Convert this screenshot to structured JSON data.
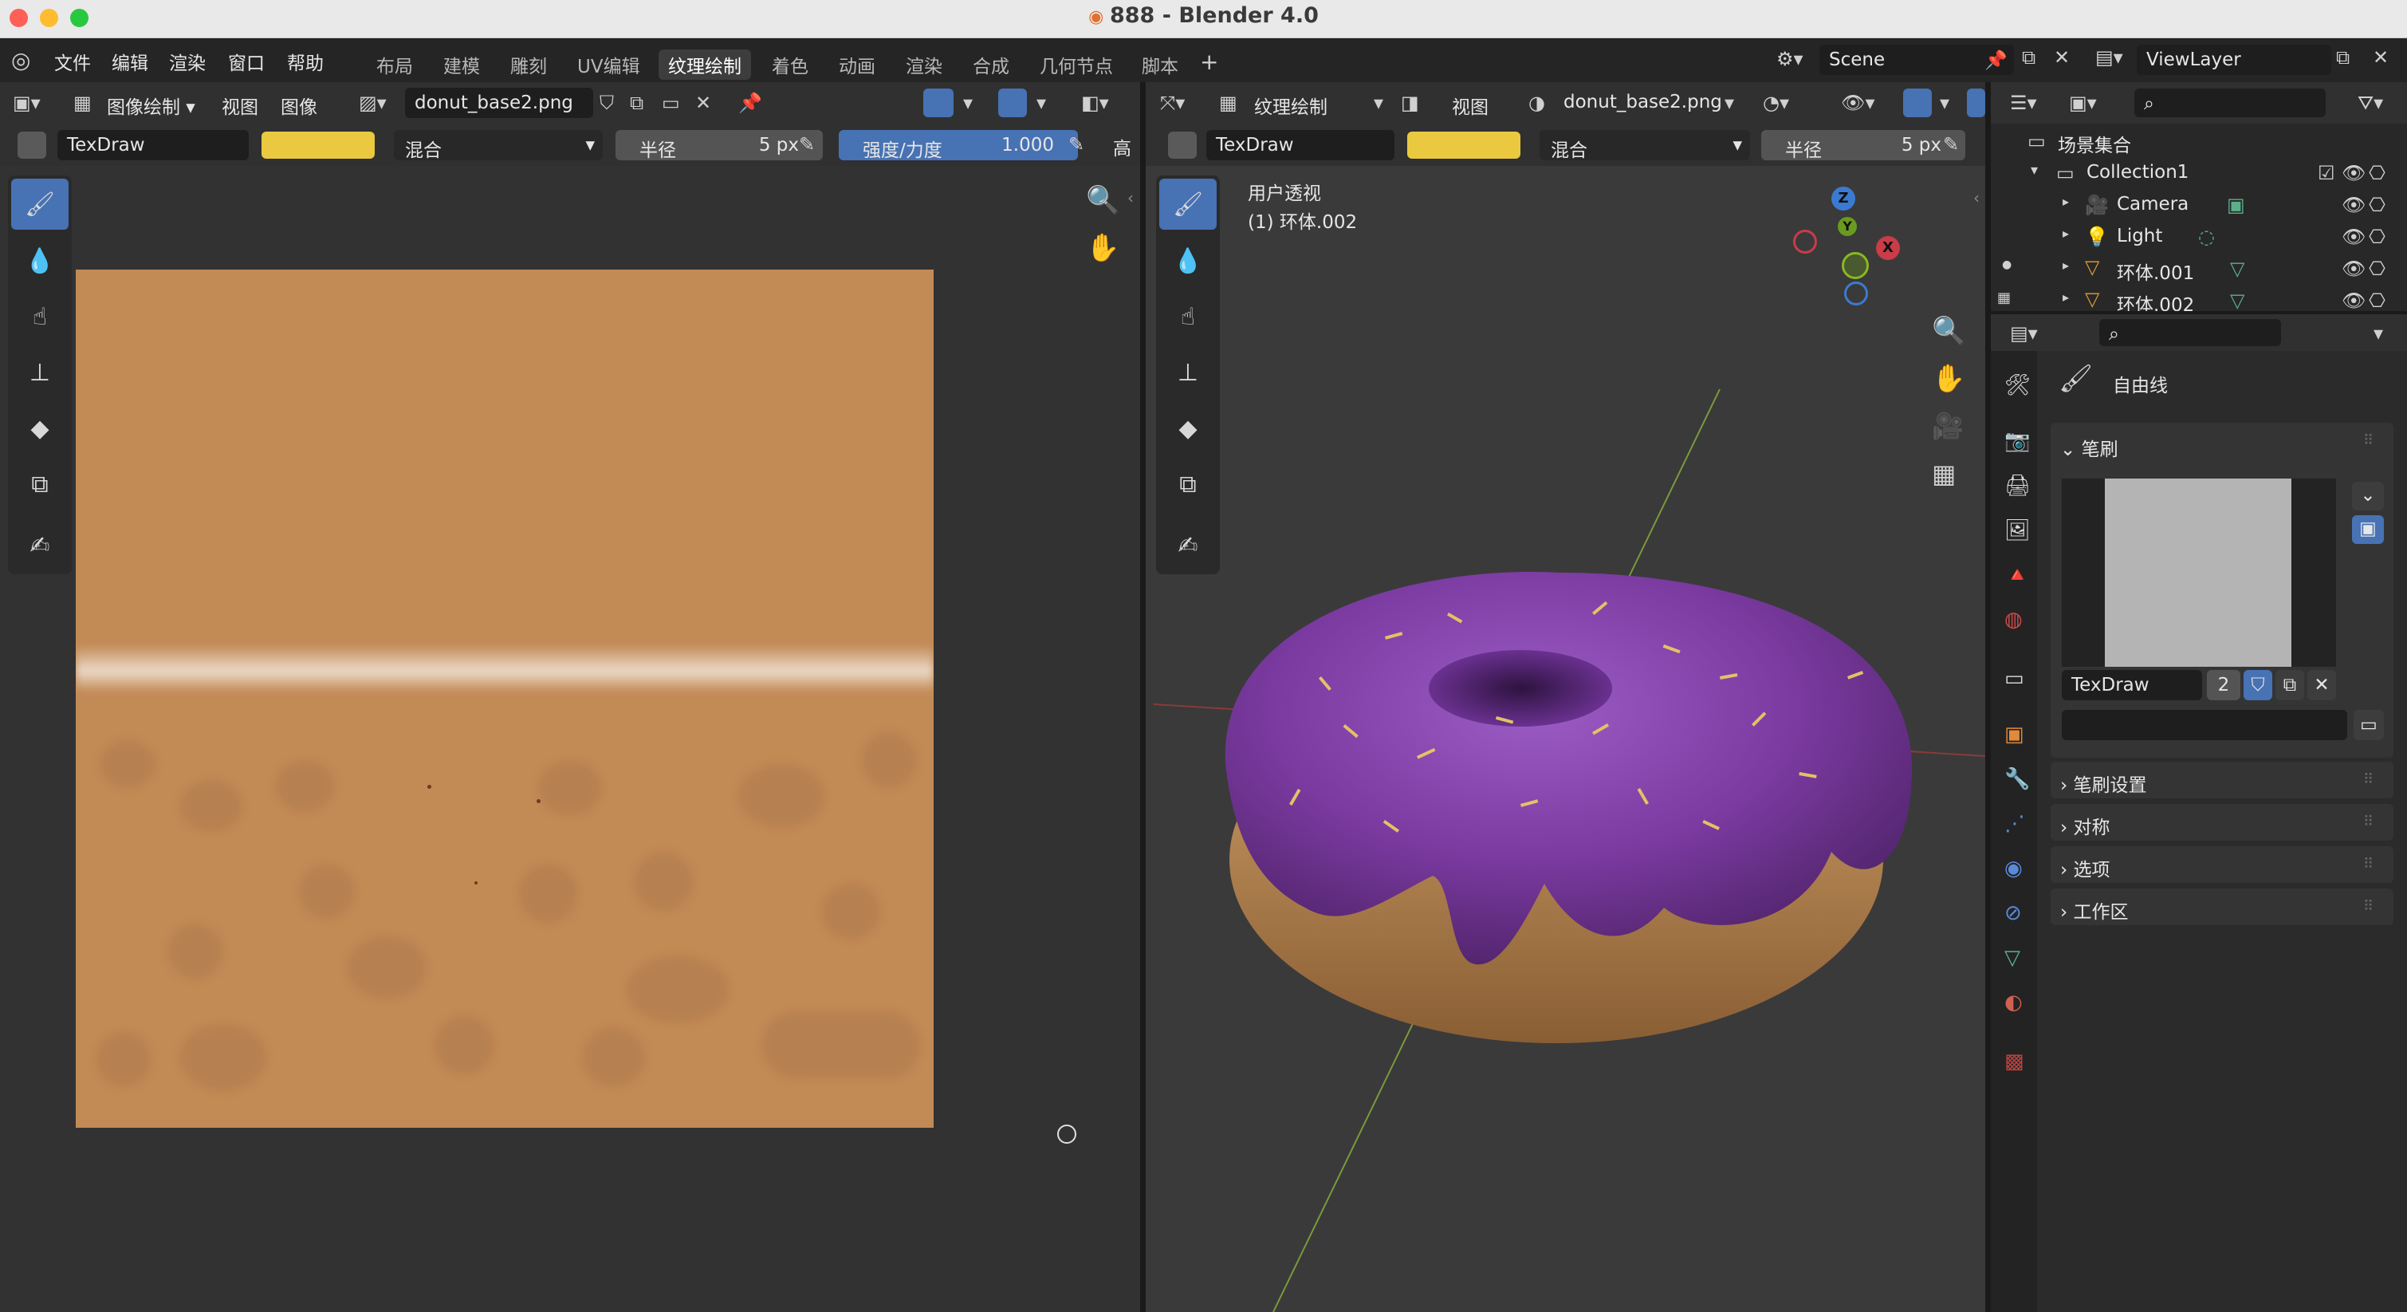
{
  "window": {
    "title": "888 - Blender 4.0"
  },
  "menu": [
    "文件",
    "编辑",
    "渲染",
    "窗口",
    "帮助"
  ],
  "workspaces": [
    "布局",
    "建模",
    "雕刻",
    "UV编辑",
    "纹理绘制",
    "着色",
    "动画",
    "渲染",
    "合成",
    "几何节点",
    "脚本"
  ],
  "workspace_active_index": 4,
  "scene": {
    "name": "Scene",
    "view_layer": "ViewLayer"
  },
  "image_editor": {
    "mode": "图像绘制",
    "menus": [
      "视图",
      "图像"
    ],
    "image_name": "donut_base2.png",
    "brush": "TexDraw",
    "blend": "混合",
    "radius_label": "半径",
    "radius_value": "5 px",
    "strength_label": "强度/力度",
    "strength_value": "1.000",
    "more_label": "高"
  },
  "viewport": {
    "mode": "纹理绘制",
    "menu": "视图",
    "image_name": "donut_base2.png",
    "brush": "TexDraw",
    "blend": "混合",
    "radius_label": "半径",
    "radius_value": "5 px",
    "view_name": "用户透视",
    "object_info": "(1) 环体.002",
    "gizmo": {
      "z": "Z",
      "y": "Y",
      "x": "X"
    }
  },
  "outliner": {
    "root": "场景集合",
    "collection": "Collection1",
    "items": [
      "Camera",
      "Light",
      "环体.001",
      "环体.002"
    ]
  },
  "properties": {
    "tool_name": "自由线",
    "brush_panel": "笔刷",
    "brush_name": "TexDraw",
    "brush_users": "2",
    "sections": [
      "笔刷设置",
      "对称",
      "选项",
      "工作区"
    ]
  },
  "colors": {
    "accent": "#4772b3",
    "brush_color": "#eac940",
    "texture_base": "#c28a55",
    "donut_icing": "#7a3aa0"
  }
}
